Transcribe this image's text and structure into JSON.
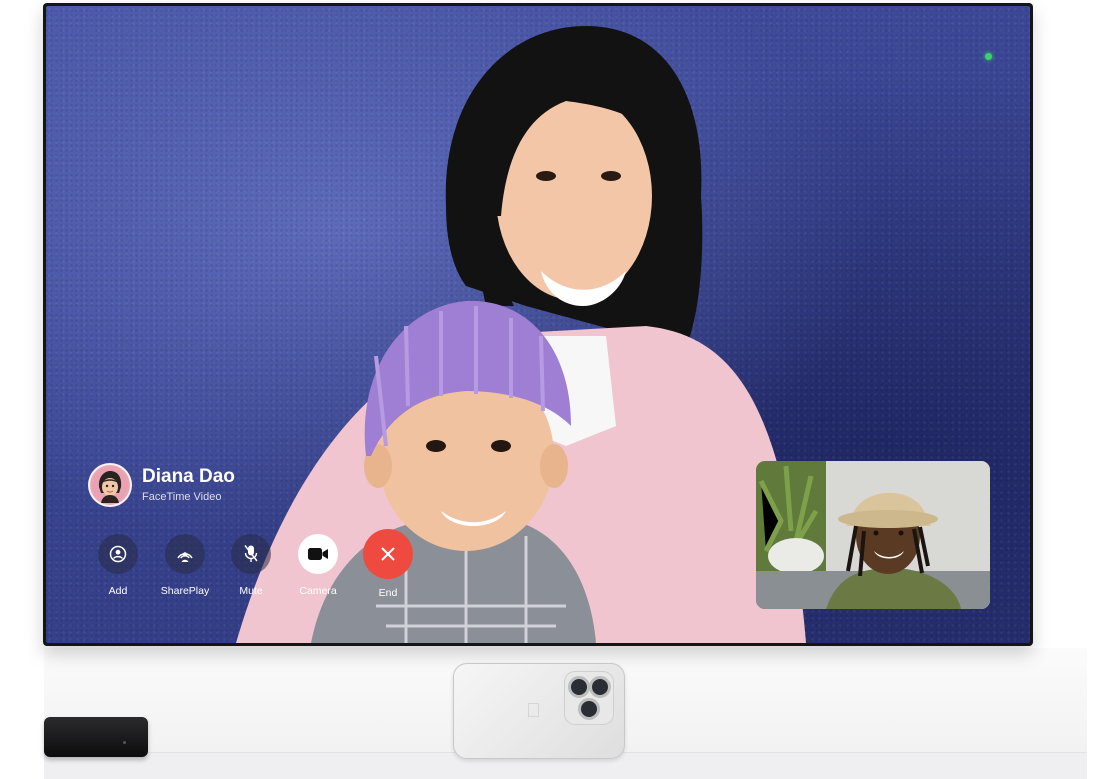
{
  "caller": {
    "name": "Diana Dao",
    "subtitle": "FaceTime Video"
  },
  "controls": [
    {
      "label": "Add",
      "icon": "person-add-icon"
    },
    {
      "label": "SharePlay",
      "icon": "shareplay-icon"
    },
    {
      "label": "Mute",
      "icon": "microphone-mute-icon"
    },
    {
      "label": "Camera",
      "icon": "video-camera-icon"
    },
    {
      "label": "End",
      "icon": "close-icon"
    }
  ],
  "colors": {
    "end_button": "#ef4a3f",
    "camera_button": "#ffffff",
    "active_indicator": "#3bd16b",
    "wall": "#3b4795"
  },
  "status": {
    "camera_active_indicator": "green-dot"
  }
}
